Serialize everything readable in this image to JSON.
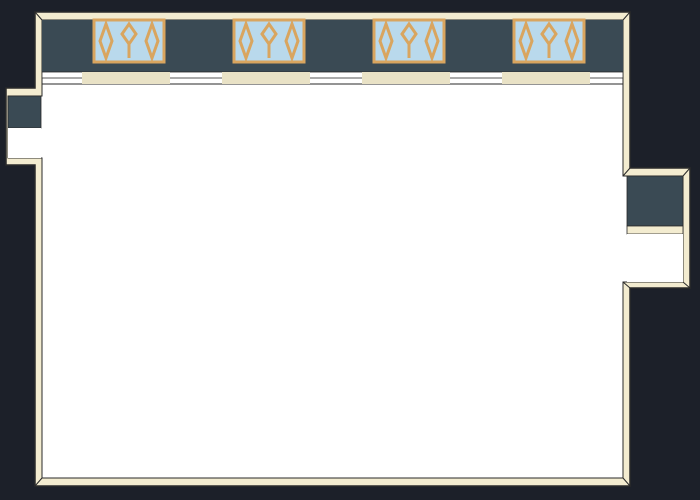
{
  "scene": {
    "kind": "top-down room map",
    "windows_on_top_wall": 4,
    "doorways": [
      "west",
      "east"
    ]
  },
  "colors": {
    "void": "#1c2029",
    "wall_trim": "#f3ecd0",
    "wall_outline": "#2a2a2a",
    "wall_face": "#3a4a54",
    "floor": "#ffffff",
    "window_frame": "#d9a55f",
    "window_glass": "#b9d9ec",
    "window_sill_shadow": "#e9e2c6"
  }
}
